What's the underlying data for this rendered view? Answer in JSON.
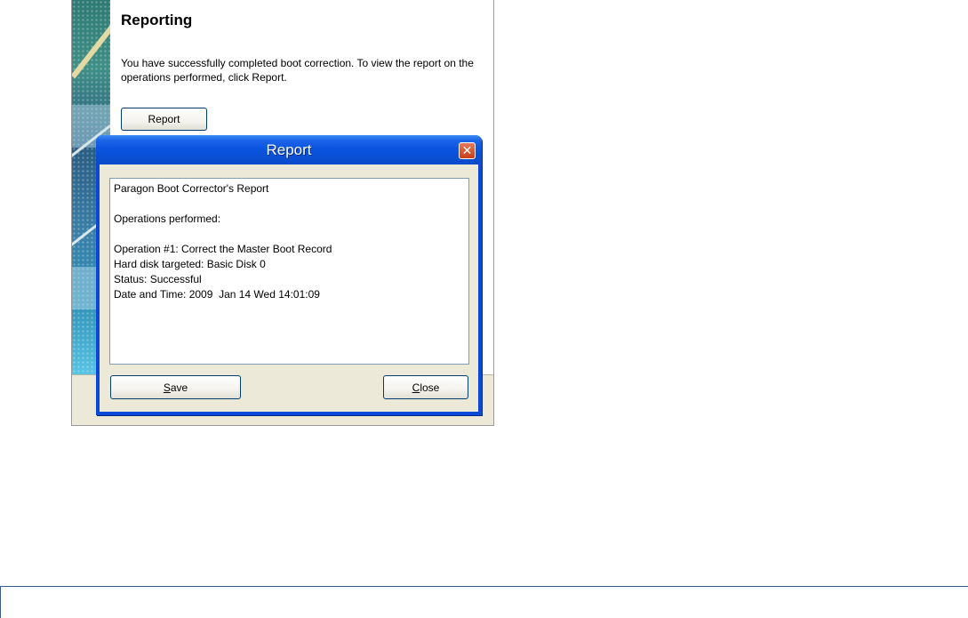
{
  "wizard": {
    "title": "Reporting",
    "message": "You have successfully completed boot correction. To view the report on the operations performed, click Report.",
    "report_button_label": "Report"
  },
  "dialog": {
    "title": "Report",
    "close_glyph": "✕",
    "report_lines": [
      "Paragon Boot Corrector's Report",
      "",
      "Operations performed:",
      "",
      "Operation #1: Correct the Master Boot Record",
      "Hard disk targeted: Basic Disk 0",
      "Status: Successful",
      "Date and Time: 2009  Jan 14 Wed 14:01:09"
    ],
    "save_button": {
      "accesskey": "S",
      "rest": "ave"
    },
    "close_button": {
      "accesskey": "C",
      "rest": "lose"
    }
  },
  "colors": {
    "titlebar": "#0b55e1",
    "dialog_face": "#ece9d8",
    "close_button": "#d7532c"
  }
}
